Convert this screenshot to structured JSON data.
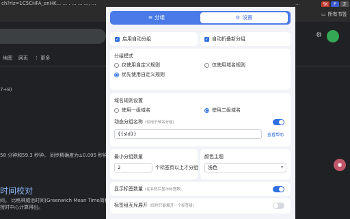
{
  "browser": {
    "url_left": "ch?rlz=1C5CHFA_enHK... ... . ... ... ..., ...",
    "url_right": "...",
    "bookmarks_label": "所有书签",
    "ext_labels": [
      "SK",
      "P",
      "Z"
    ]
  },
  "page": {
    "tabs": [
      "地图",
      "网页",
      "⋮ 更多"
    ],
    "snippet1": "7+8)",
    "snippet2": "58 分钟和59.3 秒钟。 同步精确度为±0.005 秒钟。",
    "snippet2_right": "",
    "heading": "时间校对",
    "snippet3": "间。 比格林威治时间(Greenwich Mean Time简称",
    "snippet3_right": "",
    "snippet4": "授时中心计算得出。"
  },
  "popup": {
    "tabs": {
      "group": {
        "icon": "≡",
        "label": "分组"
      },
      "settings": {
        "icon": "⚙",
        "label": "设置"
      }
    },
    "auto_group": {
      "label": "启用自动分组",
      "checked": true
    },
    "auto_collapse": {
      "label": "自动折叠新分组",
      "checked": true
    },
    "group_mode": {
      "title": "分组模式",
      "options": [
        {
          "label": "仅使用自定义规则",
          "selected": false
        },
        {
          "label": "仅使用域名规则",
          "selected": false
        },
        {
          "label": "优先使用自定义规则",
          "selected": true
        }
      ]
    },
    "domain_rule": {
      "title": "域名规则设置",
      "options": [
        {
          "label": "使用一级域名",
          "selected": false
        },
        {
          "label": "使用二级域名",
          "selected": true
        }
      ]
    },
    "dynamic_name": {
      "title": "动态分组名称",
      "hint": "(仅用于域名分组)",
      "enabled": true,
      "value": "{{sld}}",
      "help_link": "查看帮助"
    },
    "min_group": {
      "title": "最小分组数量",
      "value": "2",
      "suffix": "个标签页以上才分组"
    },
    "color_theme": {
      "title": "颜色主题",
      "value": "浅色"
    },
    "show_count": {
      "title": "显示标签数量",
      "hint": "(在名称后显示标签数)",
      "enabled": true
    },
    "accordion": {
      "title": "标签组互斥展开",
      "hint": "(同时只能展开一个标签组)",
      "enabled": false
    }
  }
}
